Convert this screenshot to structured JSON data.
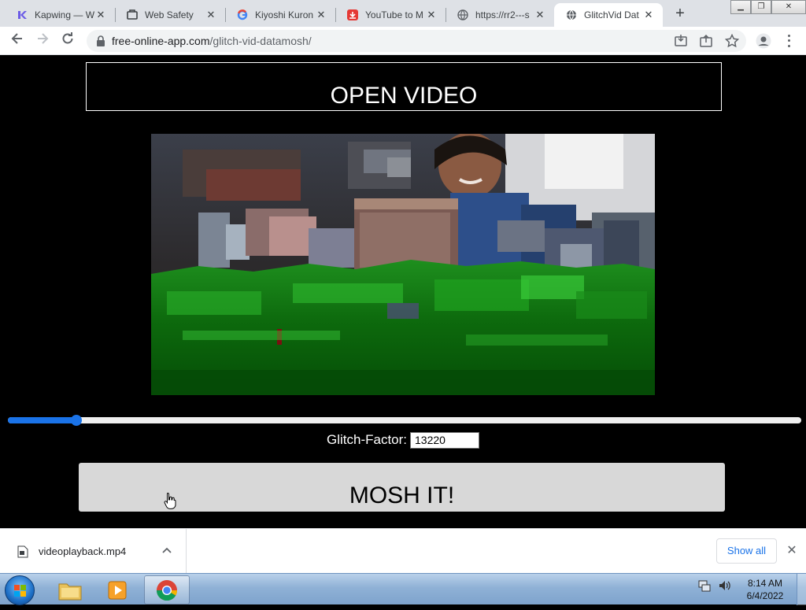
{
  "browser": {
    "tabs": [
      {
        "title": "Kapwing — W",
        "icon": "kapwing-icon"
      },
      {
        "title": "Web Safety",
        "icon": "web-safety-icon"
      },
      {
        "title": "Kiyoshi Kuron",
        "icon": "google-icon"
      },
      {
        "title": "YouTube to M",
        "icon": "download-icon"
      },
      {
        "title": "https://rr2---s",
        "icon": "globe-icon"
      },
      {
        "title": "GlitchVid Dat",
        "icon": "globe-icon",
        "active": true
      }
    ],
    "new_tab_label": "+",
    "url_host": "free-online-app.com",
    "url_path": "/glitch-vid-datamosh/"
  },
  "page": {
    "open_button_label": "OPEN VIDEO",
    "glitch_label": "Glitch-Factor:",
    "glitch_value": "13220",
    "slider_fraction": 0.08,
    "mosh_button_label": "MOSH IT!"
  },
  "downloads": {
    "file_name": "videoplayback.mp4",
    "show_all_label": "Show all"
  },
  "taskbar": {
    "time": "8:14 AM",
    "date": "6/4/2022"
  },
  "colors": {
    "accent": "#1a73e8",
    "page_background": "#000000",
    "mosh_button": "#d8d8d8"
  }
}
